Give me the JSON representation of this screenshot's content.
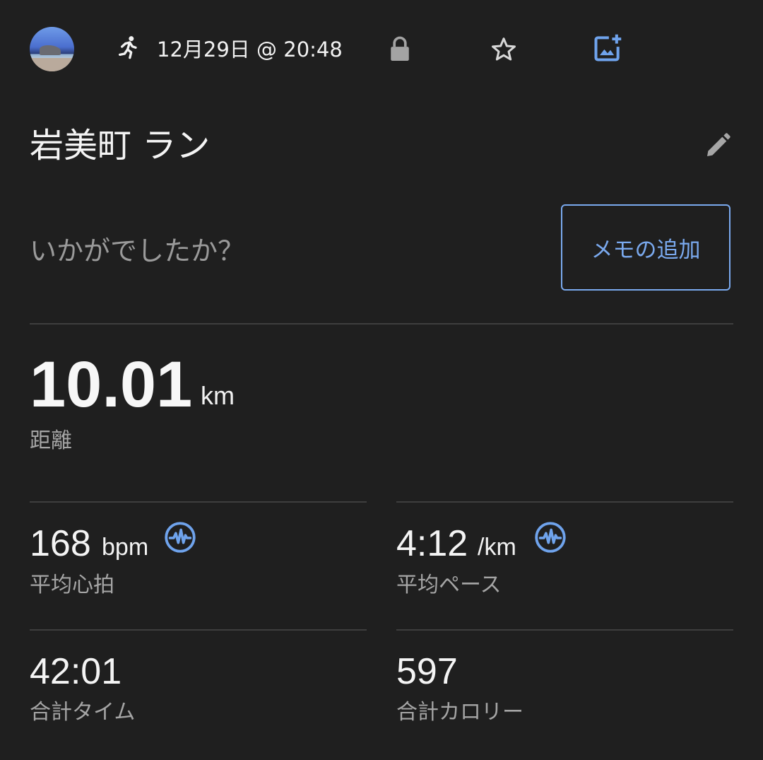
{
  "header": {
    "activity_icon": "running-person-icon",
    "timestamp": "12月29日 @ 20:48",
    "privacy_icon": "lock-icon",
    "favorite_icon": "star-outline-icon",
    "add_photo_icon": "add-photo-icon"
  },
  "activity": {
    "title": "岩美町 ラン",
    "edit_icon": "pencil-icon",
    "question": "いかがでしたか？",
    "memo_button_label": "メモの追加"
  },
  "distance": {
    "value": "10.01",
    "unit": "km",
    "label": "距離"
  },
  "stats": [
    {
      "value": "168",
      "unit": "bpm",
      "label": "平均心拍",
      "icon": "pulse-icon"
    },
    {
      "value": "4:12",
      "unit": "/km",
      "label": "平均ペース",
      "icon": "pulse-icon"
    },
    {
      "value": "42:01",
      "unit": "",
      "label": "合計タイム"
    },
    {
      "value": "597",
      "unit": "",
      "label": "合計カロリー"
    }
  ],
  "colors": {
    "background": "#1f1f1f",
    "accent": "#7aa9ee",
    "divider": "#3e3e3e",
    "secondary_text": "#a5a5a5"
  }
}
